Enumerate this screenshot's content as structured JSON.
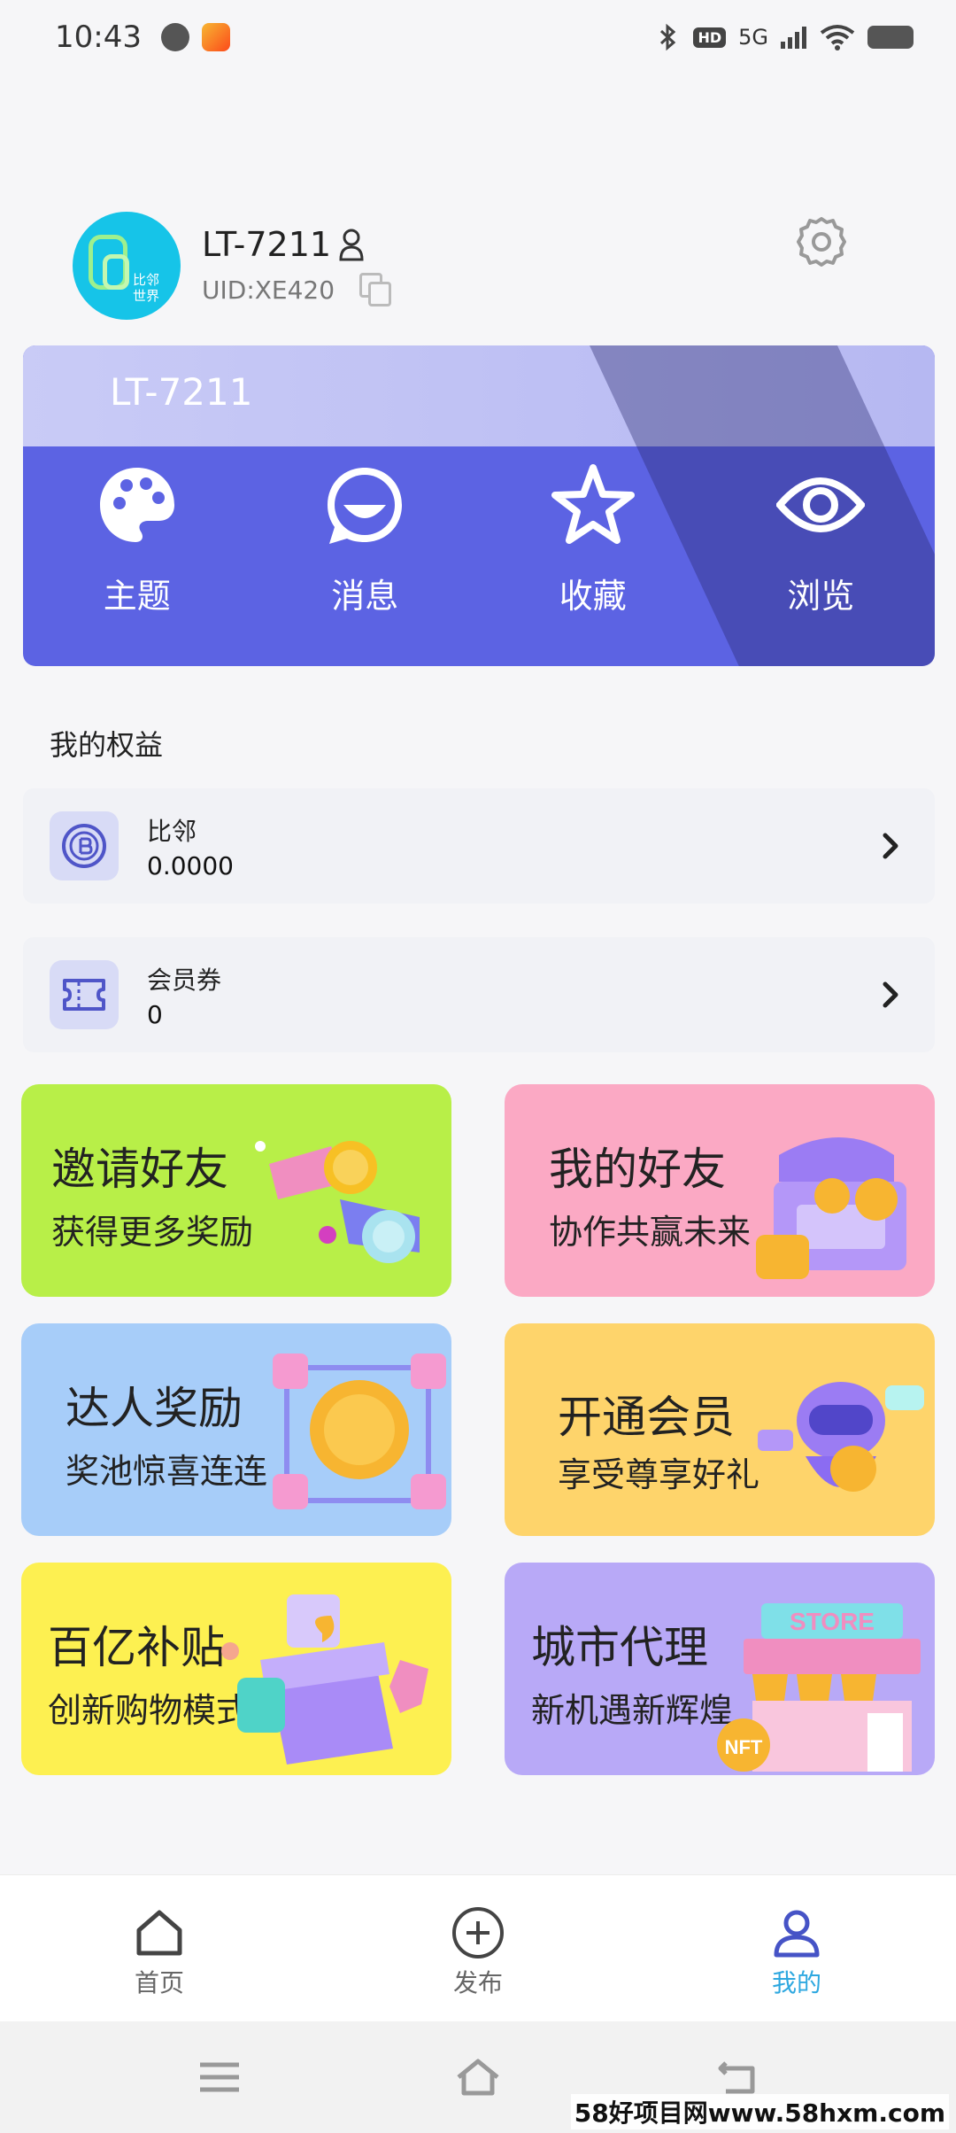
{
  "status_bar": {
    "time": "10:43",
    "network": "5G",
    "hd": "HD"
  },
  "profile": {
    "name": "LT-7211",
    "uid": "UID:XE420",
    "avatar_text": "比邻 世界"
  },
  "member_card": {
    "title": "LT-7211",
    "actions": [
      {
        "label": "主题",
        "icon": "palette-icon"
      },
      {
        "label": "消息",
        "icon": "message-icon"
      },
      {
        "label": "收藏",
        "icon": "star-icon"
      },
      {
        "label": "浏览",
        "icon": "eye-icon"
      }
    ]
  },
  "benefits": {
    "title": "我的权益",
    "items": [
      {
        "name": "比邻",
        "value": "0.0000",
        "icon": "coin-icon"
      },
      {
        "name": "会员券",
        "value": "0",
        "icon": "ticket-icon"
      }
    ]
  },
  "promos": [
    {
      "title": "邀请好友",
      "subtitle": "获得更多奖励",
      "color": "#b8ef48"
    },
    {
      "title": "我的好友",
      "subtitle": "协作共赢未来",
      "color": "#fba9c4"
    },
    {
      "title": "达人奖励",
      "subtitle": "奖池惊喜连连",
      "color": "#a7cdf9"
    },
    {
      "title": "开通会员",
      "subtitle": "享受尊享好礼",
      "color": "#fed46b"
    },
    {
      "title": "百亿补贴",
      "subtitle": "创新购物模式",
      "color": "#fdf051"
    },
    {
      "title": "城市代理",
      "subtitle": "新机遇新辉煌",
      "color": "#b8a9f7"
    }
  ],
  "promo_art_text": {
    "store": "STORE",
    "nft": "NFT"
  },
  "bottom_nav": [
    {
      "label": "首页",
      "icon": "home-icon",
      "active": false
    },
    {
      "label": "发布",
      "icon": "plus-circle-icon",
      "active": false
    },
    {
      "label": "我的",
      "icon": "user-icon",
      "active": true
    }
  ],
  "colors": {
    "card": "#5c63e3",
    "active_nav": "#2ea8e0"
  },
  "watermark": "58好项目网www.58hxm.com"
}
